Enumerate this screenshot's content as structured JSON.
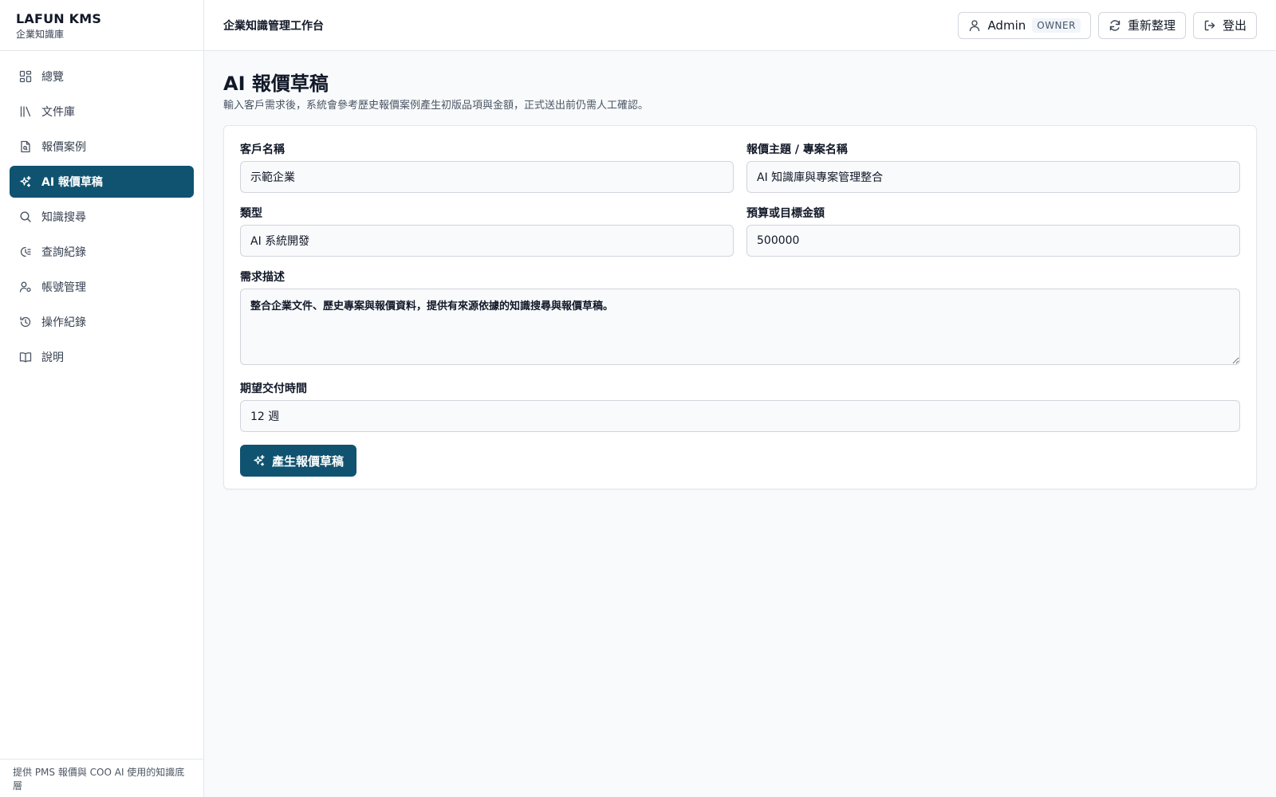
{
  "brand": {
    "name": "LAFUN KMS",
    "subtitle": "企業知識庫"
  },
  "sidebar": {
    "items": [
      {
        "label": "總覽",
        "icon": "dashboard-icon",
        "active": false
      },
      {
        "label": "文件庫",
        "icon": "library-icon",
        "active": false
      },
      {
        "label": "報價案例",
        "icon": "file-search-icon",
        "active": false
      },
      {
        "label": "AI 報價草稿",
        "icon": "sparkles-icon",
        "active": true
      },
      {
        "label": "知識搜尋",
        "icon": "search-icon",
        "active": false
      },
      {
        "label": "查詢紀錄",
        "icon": "history-icon",
        "active": false
      },
      {
        "label": "帳號管理",
        "icon": "user-cog-icon",
        "active": false
      },
      {
        "label": "操作紀錄",
        "icon": "clock-rotate-icon",
        "active": false
      },
      {
        "label": "說明",
        "icon": "book-open-icon",
        "active": false
      }
    ],
    "footer": "提供 PMS 報價與 COO AI 使用的知識底層"
  },
  "header": {
    "title": "企業知識管理工作台",
    "user": {
      "name": "Admin",
      "role": "OWNER"
    },
    "refresh_label": "重新整理",
    "logout_label": "登出"
  },
  "page": {
    "title": "AI 報價草稿",
    "description": "輸入客戶需求後，系統會參考歷史報價案例產生初版品項與金額，正式送出前仍需人工確認。"
  },
  "form": {
    "customer": {
      "label": "客戶名稱",
      "value": "示範企業"
    },
    "project": {
      "label": "報價主題 / 專案名稱",
      "value": "AI 知識庫與專案管理整合"
    },
    "type": {
      "label": "類型",
      "value": "AI 系統開發"
    },
    "budget": {
      "label": "預算或目標金額",
      "value": "500000"
    },
    "requirement": {
      "label": "需求描述",
      "value": "整合企業文件、歷史專案與報價資料，提供有來源依據的知識搜尋與報價草稿。"
    },
    "delivery": {
      "label": "期望交付時間",
      "value": "12 週"
    },
    "submit_label": "產生報價草稿"
  },
  "colors": {
    "accent": "#0f5370",
    "border": "#e5e7eb",
    "background": "#f8fafc"
  }
}
